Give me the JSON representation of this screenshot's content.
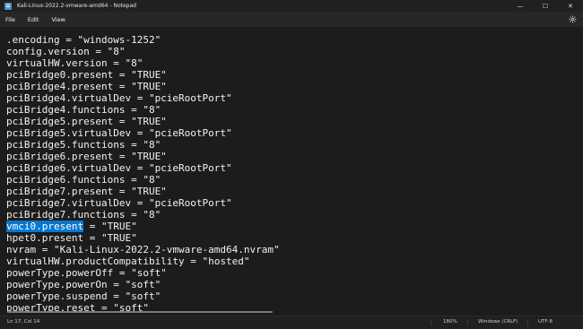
{
  "window": {
    "title": "Kali-Linux-2022.2-vmware-amd64 - Notepad",
    "minimize_glyph": "—",
    "maximize_glyph": "☐",
    "close_glyph": "✕"
  },
  "menu": {
    "file": "File",
    "edit": "Edit",
    "view": "View"
  },
  "editor": {
    "lines": [
      ".encoding = \"windows-1252\"",
      "config.version = \"8\"",
      "virtualHW.version = \"8\"",
      "pciBridge0.present = \"TRUE\"",
      "pciBridge4.present = \"TRUE\"",
      "pciBridge4.virtualDev = \"pcieRootPort\"",
      "pciBridge4.functions = \"8\"",
      "pciBridge5.present = \"TRUE\"",
      "pciBridge5.virtualDev = \"pcieRootPort\"",
      "pciBridge5.functions = \"8\"",
      "pciBridge6.present = \"TRUE\"",
      "pciBridge6.virtualDev = \"pcieRootPort\"",
      "pciBridge6.functions = \"8\"",
      "pciBridge7.present = \"TRUE\"",
      "pciBridge7.virtualDev = \"pcieRootPort\"",
      "pciBridge7.functions = \"8\"",
      "vmci0.present = \"TRUE\"",
      "hpet0.present = \"TRUE\"",
      "nvram = \"Kali-Linux-2022.2-vmware-amd64.nvram\"",
      "virtualHW.productCompatibility = \"hosted\"",
      "powerType.powerOff = \"soft\"",
      "powerType.powerOn = \"soft\"",
      "powerType.suspend = \"soft\"",
      "powerType.reset = \"soft\""
    ],
    "selected_text": "vmci0.present",
    "selected_rest": " = \"TRUE\""
  },
  "status": {
    "position": "Ln 17, Col 14",
    "zoom": "180%",
    "line_ending": "Windows (CRLF)",
    "encoding": "UTF-8"
  }
}
